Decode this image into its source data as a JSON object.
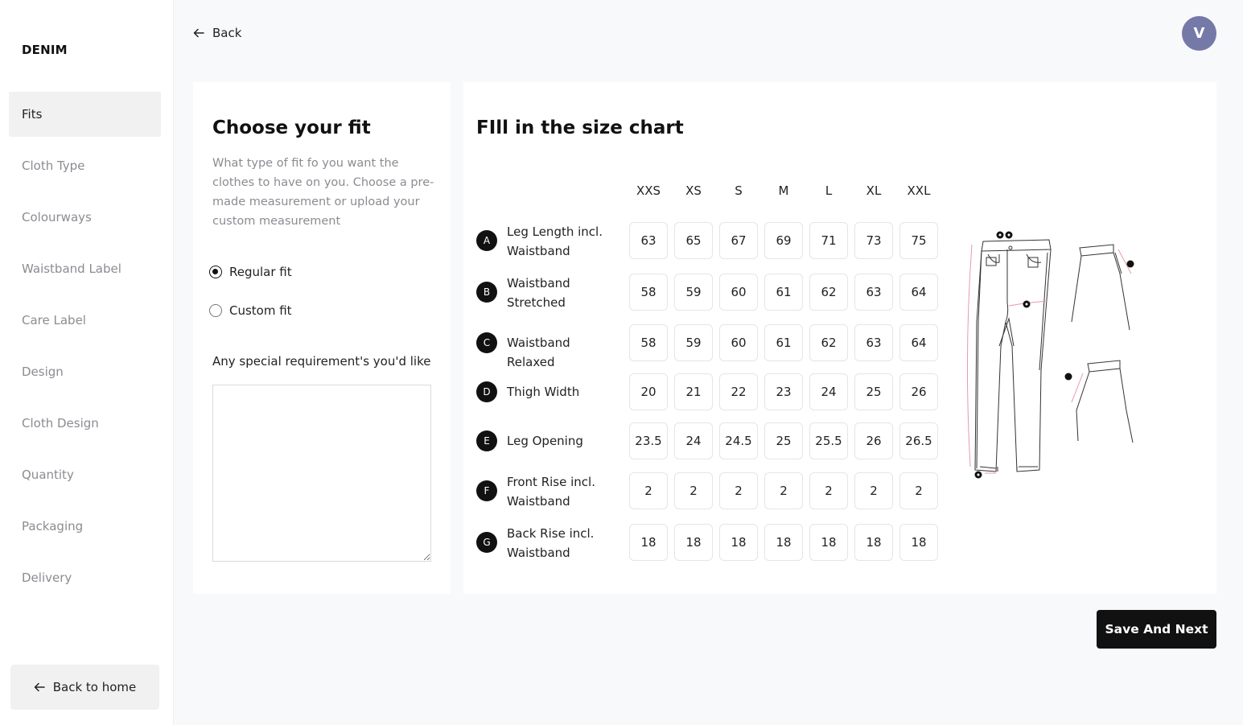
{
  "sidebar": {
    "brand": "DENIM",
    "items": [
      {
        "label": "Fits",
        "active": true
      },
      {
        "label": "Cloth Type"
      },
      {
        "label": "Colourways"
      },
      {
        "label": "Waistband Label"
      },
      {
        "label": "Care Label"
      },
      {
        "label": "Design"
      },
      {
        "label": "Cloth Design"
      },
      {
        "label": "Quantity"
      },
      {
        "label": "Packaging"
      },
      {
        "label": "Delivery"
      }
    ],
    "back_home_label": "Back to home"
  },
  "header": {
    "back_label": "Back",
    "avatar_initial": "V"
  },
  "fit": {
    "title": "Choose your fit",
    "description": "What type of fit fo you want the clothes to have on you. Choose a pre-made measurement or upload your custom measurement",
    "options": [
      {
        "label": "Regular fit",
        "checked": true
      },
      {
        "label": "Custom fit",
        "checked": false
      }
    ],
    "requirements_label": "Any special requirement's you'd like",
    "requirements_value": ""
  },
  "size_chart": {
    "title": "FIll in the size chart",
    "sizes": [
      "XXS",
      "XS",
      "S",
      "M",
      "L",
      "XL",
      "XXL"
    ],
    "rows": [
      {
        "badge": "A",
        "label": "Leg Length incl. Waistband",
        "values": [
          "63",
          "65",
          "67",
          "69",
          "71",
          "73",
          "75"
        ]
      },
      {
        "badge": "B",
        "label": "Waistband Stretched",
        "values": [
          "58",
          "59",
          "60",
          "61",
          "62",
          "63",
          "64"
        ]
      },
      {
        "badge": "C",
        "label": "Waistband Relaxed",
        "values": [
          "58",
          "59",
          "60",
          "61",
          "62",
          "63",
          "64"
        ]
      },
      {
        "badge": "D",
        "label": "Thigh Width",
        "values": [
          "20",
          "21",
          "22",
          "23",
          "24",
          "25",
          "26"
        ]
      },
      {
        "badge": "E",
        "label": "Leg Opening",
        "values": [
          "23.5",
          "24",
          "24.5",
          "25",
          "25.5",
          "26",
          "26.5"
        ]
      },
      {
        "badge": "F",
        "label": "Front Rise incl. Waistband",
        "values": [
          "2",
          "2",
          "2",
          "2",
          "2",
          "2",
          "2"
        ]
      },
      {
        "badge": "G",
        "label": "Back Rise incl. Waistband",
        "values": [
          "18",
          "18",
          "18",
          "18",
          "18",
          "18",
          "18"
        ]
      }
    ],
    "diagram_icon": "jeans-measurement-diagram"
  },
  "footer": {
    "save_label": "Save And Next"
  },
  "colors": {
    "accent": "#111111",
    "avatar": "#7579a8",
    "muted_text": "#8a8c91",
    "active_nav_bg": "#f1f1f2",
    "page_bg": "#f8f9fb"
  }
}
